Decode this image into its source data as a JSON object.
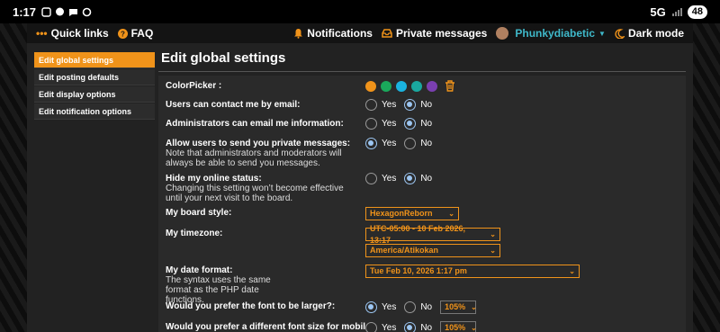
{
  "status": {
    "time": "1:17",
    "network": "5G",
    "battery": "48"
  },
  "topnav": {
    "quick_links": "Quick links",
    "faq": "FAQ",
    "notifications": "Notifications",
    "private_messages": "Private messages",
    "username": "Phunkydiabetic",
    "dark_mode": "Dark mode"
  },
  "sidebar": {
    "items": [
      {
        "label": "Edit global settings"
      },
      {
        "label": "Edit posting defaults"
      },
      {
        "label": "Edit display options"
      },
      {
        "label": "Edit notification options"
      }
    ]
  },
  "panel": {
    "title": "Edit global settings"
  },
  "colors": {
    "accent": "#f0931a",
    "swatches": [
      "#f0931a",
      "#1aa85b",
      "#1ab3e0",
      "#1aa8a0",
      "#7a3fb0"
    ]
  },
  "settings": {
    "colorpicker": {
      "label": "ColorPicker :"
    },
    "contact_email": {
      "label": "Users can contact me by email:",
      "yes": "Yes",
      "no": "No"
    },
    "admin_email": {
      "label": "Administrators can email me information:",
      "yes": "Yes",
      "no": "No"
    },
    "private_msg": {
      "label": "Allow users to send you private messages:",
      "note": "Note that administrators and moderators will always be able to send you messages.",
      "yes": "Yes",
      "no": "No"
    },
    "hide_online": {
      "label": "Hide my online status:",
      "note": "Changing this setting won’t become effective until your next visit to the board.",
      "yes": "Yes",
      "no": "No"
    },
    "board_style": {
      "label": "My board style:",
      "value": "HexagonReborn"
    },
    "timezone": {
      "label": "My timezone:",
      "value": "UTC-05:00 - 10 Feb 2026, 13:17",
      "zone": "America/Atikokan"
    },
    "date_format": {
      "label": "My date format:",
      "note": "The syntax uses the same format as the PHP date functions.",
      "value": "Tue Feb 10, 2026 1:17 pm"
    },
    "larger_font": {
      "label": "Would you prefer the font to be larger?:",
      "yes": "Yes",
      "no": "No",
      "size": "105%"
    },
    "mobile_font": {
      "label": "Would you prefer a different font size for mobile",
      "yes": "Yes",
      "no": "No",
      "size": "105%"
    }
  }
}
